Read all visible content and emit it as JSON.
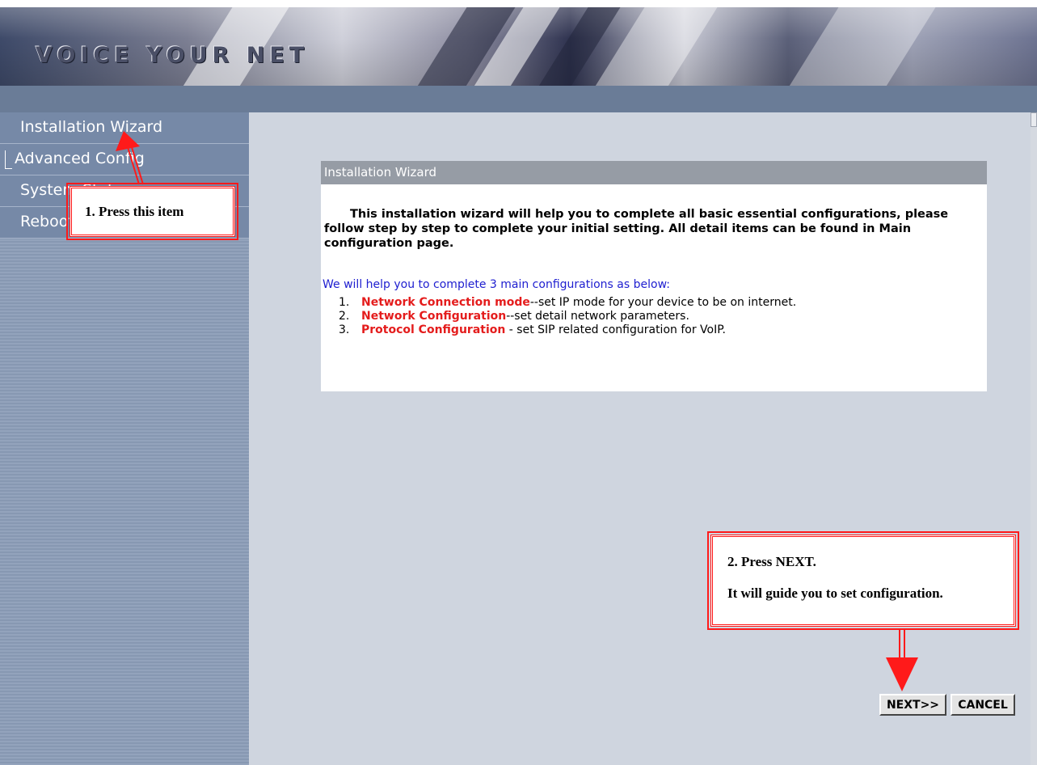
{
  "banner": {
    "brand": "VOICE YOUR NET"
  },
  "sidebar": {
    "items": [
      {
        "label": "Installation Wizard"
      },
      {
        "label": "Advanced Config"
      },
      {
        "label": "System Status"
      },
      {
        "label": "Reboot"
      }
    ]
  },
  "panel": {
    "title": "Installation Wizard",
    "intro": "This installation wizard will help you to complete all basic essential configurations, please follow step by step to complete your initial setting. All detail items can be found in Main configuration page.",
    "help_line": "We will help you to complete 3 main configurations as below:",
    "steps": [
      {
        "num": "1.",
        "key": "Network Connection mode",
        "desc": "--set IP mode for your device to be on internet."
      },
      {
        "num": "2.",
        "key": "Network Configuration",
        "desc": "--set detail network parameters."
      },
      {
        "num": "3.",
        "key": "Protocol Configuration",
        "desc": " - set SIP related configuration for VoIP."
      }
    ]
  },
  "callouts": {
    "step1": "1. Press this item",
    "step2_line1": "2. Press NEXT.",
    "step2_line2": "It will guide you to set configuration."
  },
  "buttons": {
    "next": "NEXT>>",
    "cancel": "CANCEL"
  },
  "colors": {
    "annotation_red": "#ff1a1a",
    "step_key_red": "#e41c1c",
    "help_blue": "#2020d0"
  }
}
